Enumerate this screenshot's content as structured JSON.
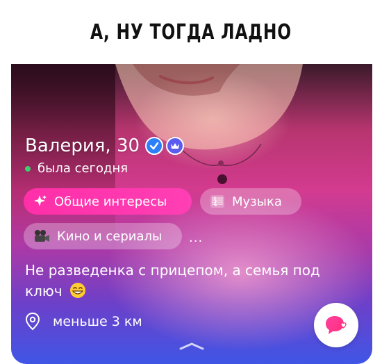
{
  "caption": "А, НУ ТОГДА ЛАДНО",
  "profile": {
    "name": "Валерия, 30",
    "status": "была сегодня",
    "chips": {
      "common_interests": "Общие интересы",
      "music": "Музыка",
      "movies": "Кино и сериалы"
    },
    "more": "...",
    "bio": "Не разведенка с прицепом, а семья под ключ",
    "location": "меньше 3 км"
  },
  "icons": {
    "verified": "verified-check-icon",
    "premium": "crown-icon",
    "sparkle": "sparkle-icon",
    "music": "music-staff-icon",
    "movies": "movie-camera-icon",
    "location": "location-pin-icon",
    "like": "chat-heart-icon",
    "expand": "chevron-up-icon"
  },
  "colors": {
    "accent_pink": "#ff2fa8",
    "verified_blue": "#2d7ff9",
    "online_green": "#3bd16f"
  }
}
